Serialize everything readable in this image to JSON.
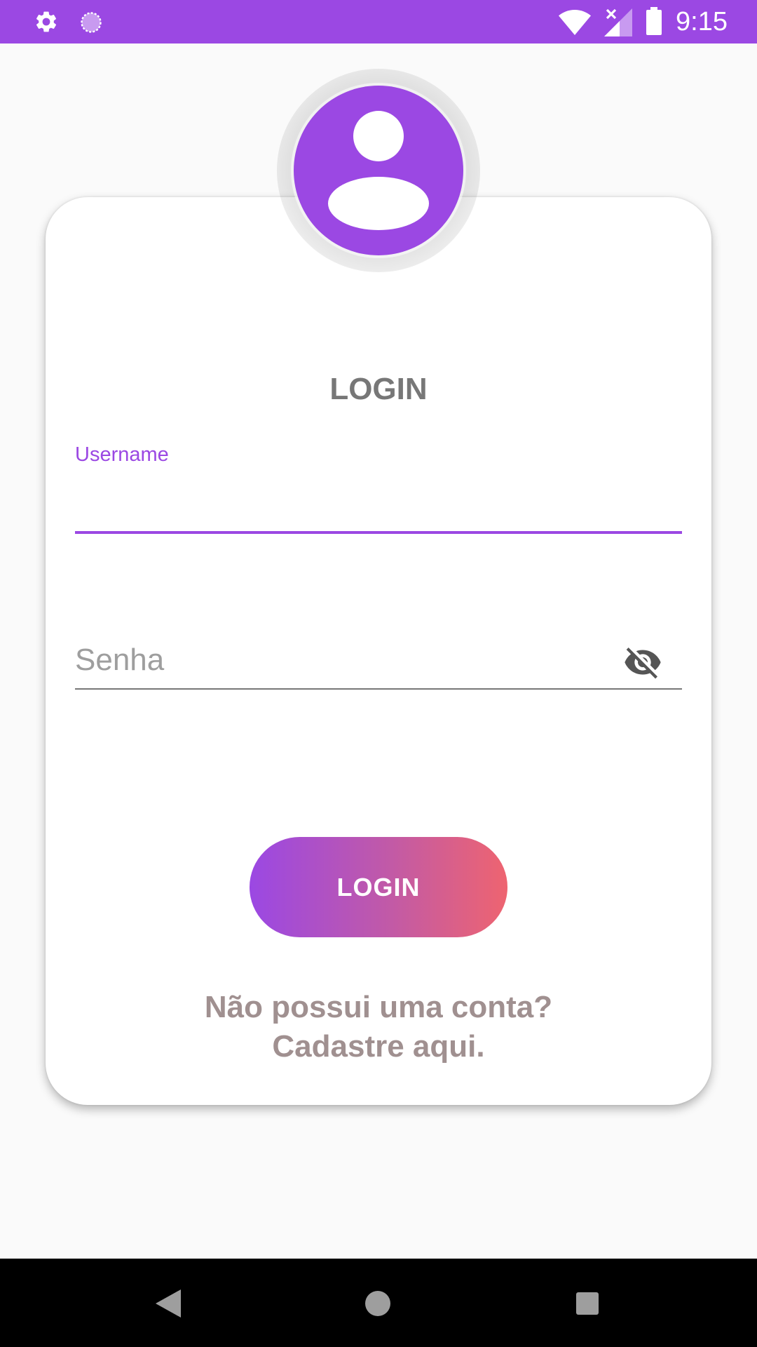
{
  "status_bar": {
    "time": "9:15",
    "icons": [
      "gear-icon",
      "sync-icon",
      "wifi-icon",
      "signal-icon",
      "battery-icon"
    ],
    "background_color": "#9b48e3"
  },
  "form": {
    "title": "LOGIN",
    "username": {
      "label": "Username",
      "value": ""
    },
    "password": {
      "placeholder": "Senha",
      "value": "",
      "toggle_icon": "eye-off-icon"
    },
    "login_button_label": "LOGIN",
    "signup_line1": "Não possui uma conta?",
    "signup_line2": "Cadastre aqui."
  },
  "avatar": {
    "icon": "user-icon"
  },
  "nav_bar": {
    "icons": [
      "back-icon",
      "home-icon",
      "recents-icon"
    ]
  },
  "colors": {
    "accent": "#9b48e3",
    "button_gradient_start": "#9b48e3",
    "button_gradient_end": "#ee6470",
    "title_text": "#777777",
    "link_text": "#a09090"
  }
}
